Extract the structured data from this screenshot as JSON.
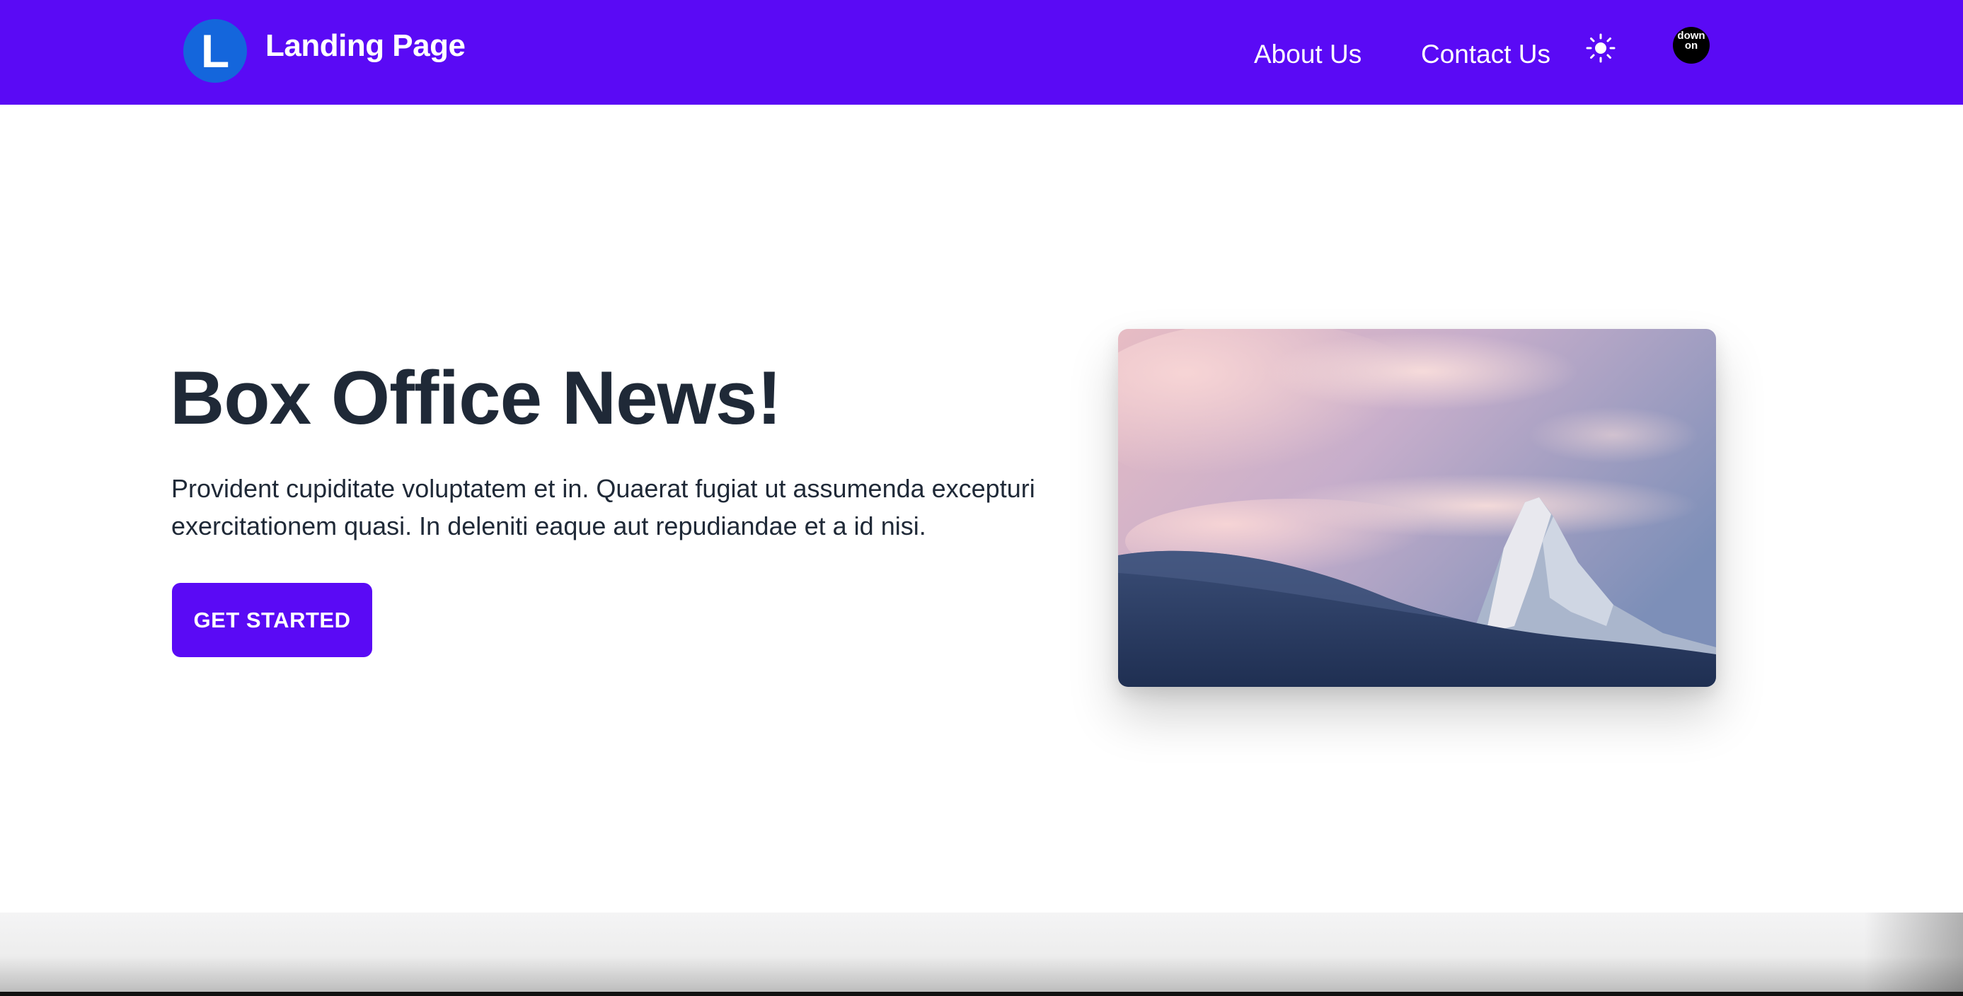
{
  "header": {
    "logo_letter": "L",
    "brand": "Landing Page",
    "nav": [
      {
        "label": "About Us"
      },
      {
        "label": "Contact Us"
      }
    ],
    "theme_icon": "sun-icon",
    "avatar_text": "down on",
    "background": "#5a0af5",
    "logo_color": "#1466dc"
  },
  "hero": {
    "title": "Box Office News!",
    "description": "Provident cupiditate voluptatem et in. Quaerat fugiat ut assumenda excepturi exercitationem quasi. In deleniti eaque aut repudiandae et a id nisi.",
    "cta_label": "GET STARTED",
    "accent": "#5a0af5",
    "text_color": "#1f2937"
  }
}
